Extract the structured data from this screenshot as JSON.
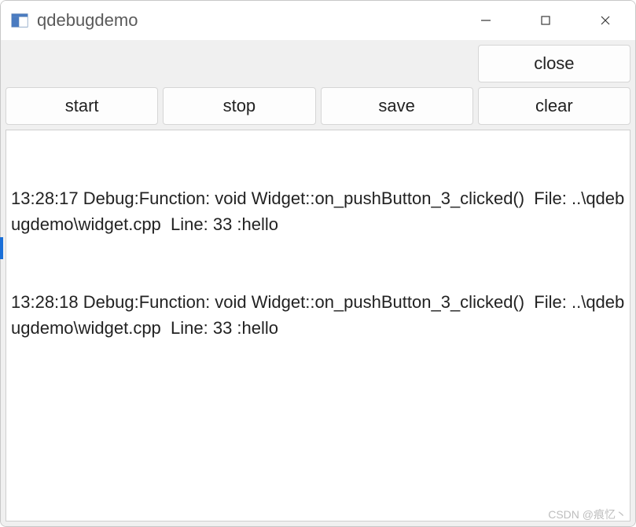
{
  "window": {
    "title": "qdebugdemo"
  },
  "buttons": {
    "close": "close",
    "start": "start",
    "stop": "stop",
    "save": "save",
    "clear": "clear"
  },
  "log": {
    "entries": [
      "13:28:17 Debug:Function: void Widget::on_pushButton_3_clicked()  File: ..\\qdebugdemo\\widget.cpp  Line: 33 :hello",
      "13:28:18 Debug:Function: void Widget::on_pushButton_3_clicked()  File: ..\\qdebugdemo\\widget.cpp  Line: 33 :hello"
    ]
  },
  "watermark": "CSDN @痕忆丶"
}
